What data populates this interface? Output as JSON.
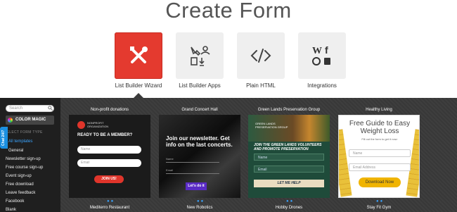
{
  "page": {
    "title": "Create Form"
  },
  "form_types": [
    {
      "label": "List Builder Wizard",
      "icon": "tools-icon",
      "active": true
    },
    {
      "label": "List Builder Apps",
      "icon": "apps-icon",
      "active": false
    },
    {
      "label": "Plain HTML",
      "icon": "code-icon",
      "active": false
    },
    {
      "label": "Integrations",
      "icon": "integrations-icon",
      "active": false
    }
  ],
  "sidebar": {
    "search_placeholder": "Search",
    "color_magic": "COLOR MAGIC",
    "section_label": "Select form type",
    "chat_label": "Chat 24/7",
    "items": [
      {
        "label": "All templates",
        "active": true
      },
      {
        "label": "General",
        "active": false
      },
      {
        "label": "Newsletter sign-up",
        "active": false
      },
      {
        "label": "Free course sign-up",
        "active": false
      },
      {
        "label": "Event sign-up",
        "active": false
      },
      {
        "label": "Free download",
        "active": false
      },
      {
        "label": "Leave feedback",
        "active": false
      },
      {
        "label": "Facebook",
        "active": false
      },
      {
        "label": "Blank",
        "active": false
      }
    ]
  },
  "templates": [
    {
      "title": "Non-profit donations",
      "logo_text": "NONPROFIT ORGANIZATION",
      "heading": "READY TO BE A MEMBER?",
      "field1": "Name",
      "field2": "Email",
      "button": "JOIN US!"
    },
    {
      "title": "Grand Concert Hall",
      "heading": "Join our newsletter. Get info on the last concerts.",
      "field1": "Name",
      "field2": "Email",
      "button": "Let's do it"
    },
    {
      "title": "Green Lands Preservation Group",
      "logo_text": "GREEN LANDS PRESERVATION GROUP",
      "heading": "JOIN THE GREEN LANDS VOLUNTEERS AND PROMOTE PRESERVATION",
      "field1": "Name",
      "field2": "Email",
      "button": "LET ME HELP"
    },
    {
      "title": "Healthy Living",
      "heading": "Free Guide to Easy Weight Loss",
      "sub": "Fill out the form to get it now:",
      "field1": "Name",
      "field2": "Email Address",
      "button": "Download Now"
    }
  ],
  "bottom_titles": [
    "Mediterro Restaurant",
    "New Robotics",
    "Hobby Drones",
    "Stay Fit Gym"
  ],
  "colors": {
    "accent": "#e43a2f",
    "link": "#3aa4ff",
    "panel": "#3a3a3a",
    "sidebar": "#1f1f1f"
  }
}
